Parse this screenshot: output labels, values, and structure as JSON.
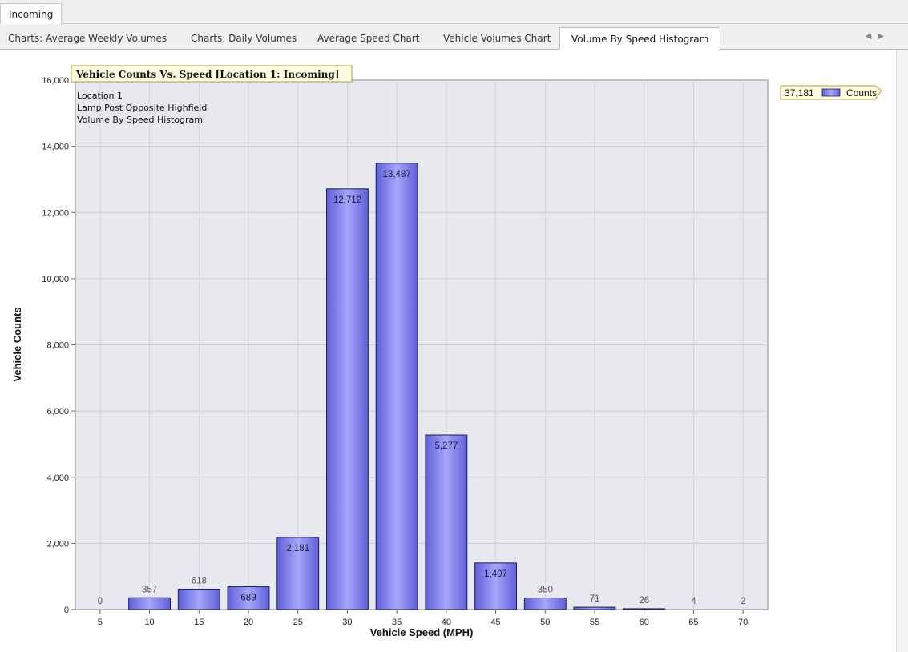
{
  "document_tabs": [
    "Incoming"
  ],
  "view_tabs": [
    "Charts: Average Weekly Volumes",
    "Charts: Daily Volumes",
    "Average Speed Chart",
    "Vehicle Volumes Chart",
    "Volume By Speed Histogram"
  ],
  "active_view_tab": "Volume By Speed Histogram",
  "chart_data": {
    "type": "bar",
    "title": "Vehicle Counts Vs. Speed [Location 1: Incoming]",
    "annotation_lines": [
      "Location 1",
      "Lamp Post Opposite Highfield",
      "Volume By Speed Histogram"
    ],
    "xlabel": "Vehicle Speed (MPH)",
    "ylabel": "Vehicle Counts",
    "categories": [
      "5",
      "10",
      "15",
      "20",
      "25",
      "30",
      "35",
      "40",
      "45",
      "50",
      "55",
      "60",
      "65",
      "70"
    ],
    "series": [
      {
        "name": "Counts",
        "values": [
          0,
          357,
          618,
          689,
          2181,
          12712,
          13487,
          5277,
          1407,
          350,
          71,
          26,
          4,
          2
        ]
      }
    ],
    "data_labels": [
      "0",
      "357",
      "618",
      "689",
      "2,181",
      "12,712",
      "13,487",
      "5,277",
      "1,407",
      "350",
      "71",
      "26",
      "4",
      "2"
    ],
    "ylim": [
      0,
      16000
    ],
    "yticks": [
      0,
      2000,
      4000,
      6000,
      8000,
      10000,
      12000,
      14000,
      16000
    ],
    "ytick_labels": [
      "0",
      "2,000",
      "4,000",
      "6,000",
      "8,000",
      "10,000",
      "12,000",
      "14,000",
      "16,000"
    ],
    "legend": {
      "total": "37,181",
      "entry": "Counts",
      "position": "top-right"
    },
    "grid": true,
    "colors": {
      "bar": "#7b7bea",
      "bar_edge": "#1c1c5a",
      "plot_bg": "#e8e9ee"
    }
  }
}
